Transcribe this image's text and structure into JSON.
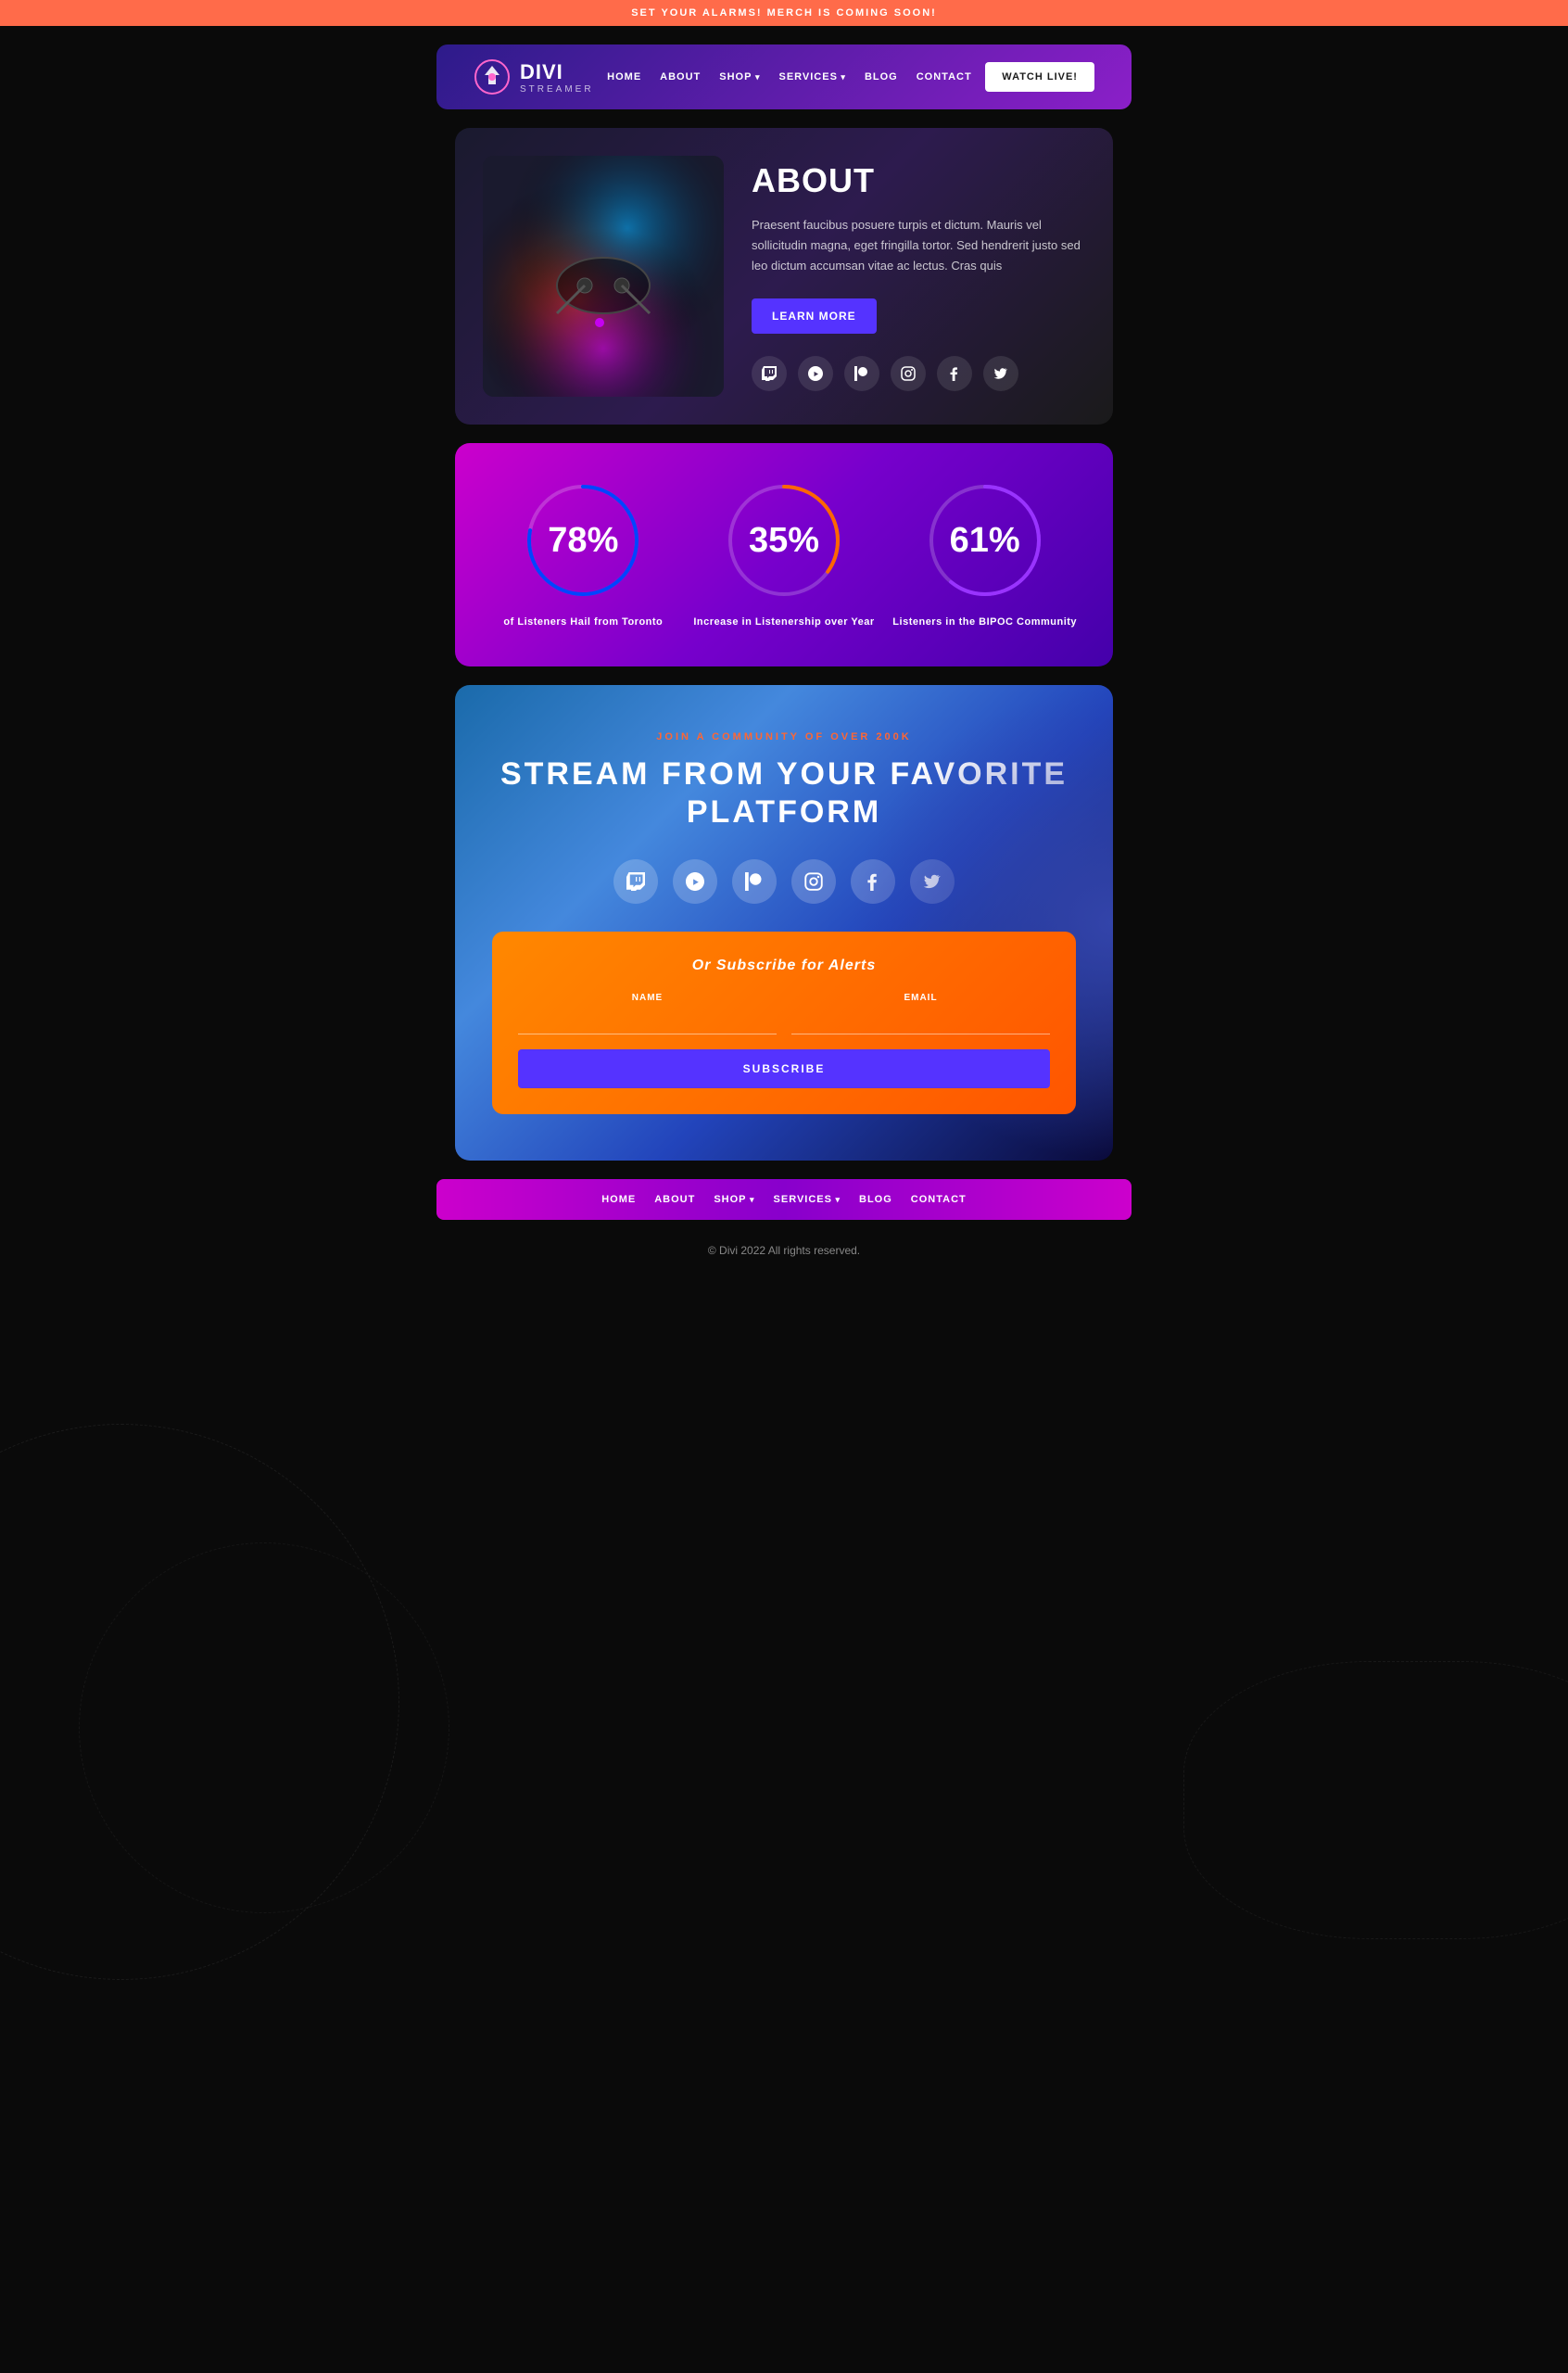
{
  "banner": {
    "text": "SET YOUR ALARMS! MERCH IS COMING SOON!"
  },
  "navbar": {
    "logo_name": "DIVI",
    "logo_sub": "STREAMER",
    "links": [
      {
        "label": "HOME",
        "has_arrow": false
      },
      {
        "label": "ABOUT",
        "has_arrow": false
      },
      {
        "label": "SHOP",
        "has_arrow": true
      },
      {
        "label": "SERVICES",
        "has_arrow": true
      },
      {
        "label": "BLOG",
        "has_arrow": false
      },
      {
        "label": "CONTACT",
        "has_arrow": false
      }
    ],
    "watch_button": "WATCH LIVE!"
  },
  "about": {
    "title": "ABOUT",
    "description": "Praesent faucibus posuere turpis et dictum. Mauris vel sollicitudin magna, eget fringilla tortor. Sed hendrerit justo sed leo dictum accumsan vitae ac lectus. Cras quis",
    "learn_more": "LEARN MORE",
    "social_icons": [
      "twitch",
      "youtube",
      "patreon",
      "instagram",
      "facebook",
      "twitter"
    ]
  },
  "stats": [
    {
      "value": "78%",
      "label": "of Listeners Hail from Toronto",
      "percent": 78,
      "color_start": "#aa00ff",
      "color_end": "#0000ff"
    },
    {
      "value": "35%",
      "label": "Increase in Listenership over Year",
      "percent": 35,
      "color_start": "#ff6600",
      "color_end": "#ff0066"
    },
    {
      "value": "61%",
      "label": "Listeners in the BIPOC Community",
      "percent": 61,
      "color_start": "#aa44ff",
      "color_end": "#6600aa"
    }
  ],
  "stream": {
    "community_label": "JOIN A COMMUNITY OF OVER 200K",
    "title_line1": "STREAM FROM YOUR FAVORITE",
    "title_line2": "PLATFORM",
    "social_icons": [
      "twitch",
      "youtube",
      "patreon",
      "instagram",
      "facebook",
      "twitter"
    ]
  },
  "subscribe": {
    "title": "Or Subscribe for Alerts",
    "name_label": "NAME",
    "name_placeholder": "",
    "email_label": "EMAIL",
    "email_placeholder": "",
    "button": "SUBSCRIBE"
  },
  "footer": {
    "links": [
      {
        "label": "HOME",
        "has_arrow": false
      },
      {
        "label": "ABOUT",
        "has_arrow": false
      },
      {
        "label": "SHOP",
        "has_arrow": true
      },
      {
        "label": "SERVICES",
        "has_arrow": true
      },
      {
        "label": "BLOG",
        "has_arrow": false
      },
      {
        "label": "CONTACT",
        "has_arrow": false
      }
    ],
    "copyright": "© Divi 2022 All rights reserved."
  }
}
